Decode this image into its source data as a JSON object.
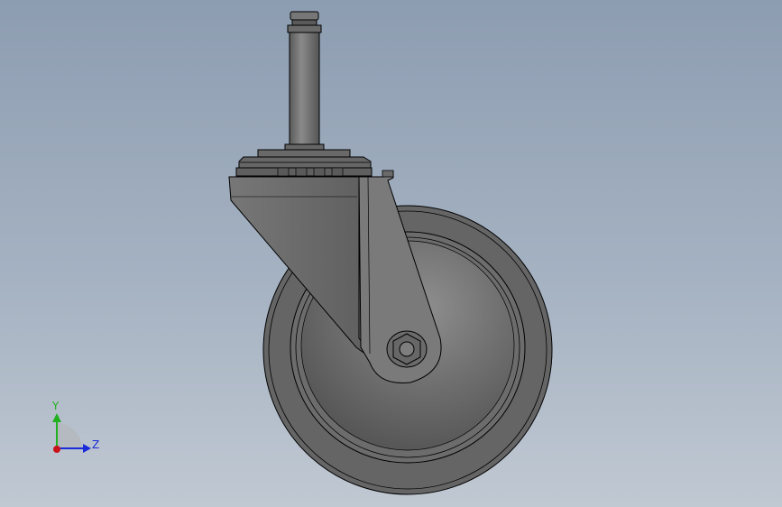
{
  "viewport": {
    "background_top": "#8d9db1",
    "background_bottom": "#c0c8d2"
  },
  "model": {
    "name": "caster-wheel-with-stem",
    "body_color": "#6b6b6b",
    "edge_color": "#000000"
  },
  "triad": {
    "y_label": "Y",
    "z_label": "Z",
    "y_color": "#20b020",
    "z_color": "#1a2bd8",
    "x_color": "#c8141a"
  }
}
